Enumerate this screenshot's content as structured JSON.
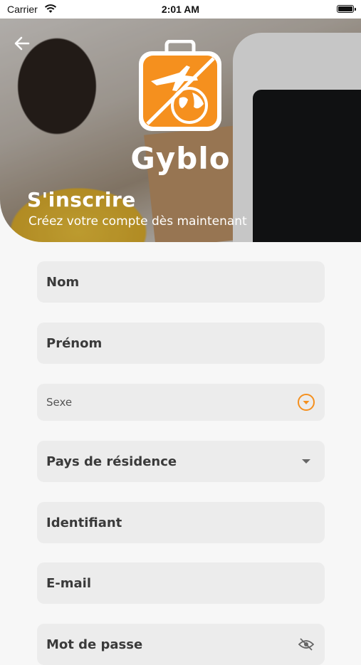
{
  "status_bar": {
    "carrier": "Carrier",
    "time": "2:01 AM"
  },
  "header": {
    "brand": "Gyblo",
    "title": "S'inscrire",
    "subtitle": "Créez votre compte dès maintenant"
  },
  "form": {
    "fields": [
      {
        "label": "Nom"
      },
      {
        "label": "Prénom"
      },
      {
        "label": "Sexe"
      },
      {
        "label": "Pays de résidence"
      },
      {
        "label": "Identifiant"
      },
      {
        "label": "E-mail"
      },
      {
        "label": "Mot de passe"
      }
    ]
  },
  "colors": {
    "accent": "#f5901e",
    "field_bg": "#ececec",
    "page_bg": "#f7f7f7"
  },
  "icons": [
    "back-arrow-icon",
    "wifi-icon",
    "battery-icon",
    "suitcase-logo-icon",
    "dropdown-circle-icon",
    "dropdown-caret-icon",
    "eye-off-icon"
  ]
}
